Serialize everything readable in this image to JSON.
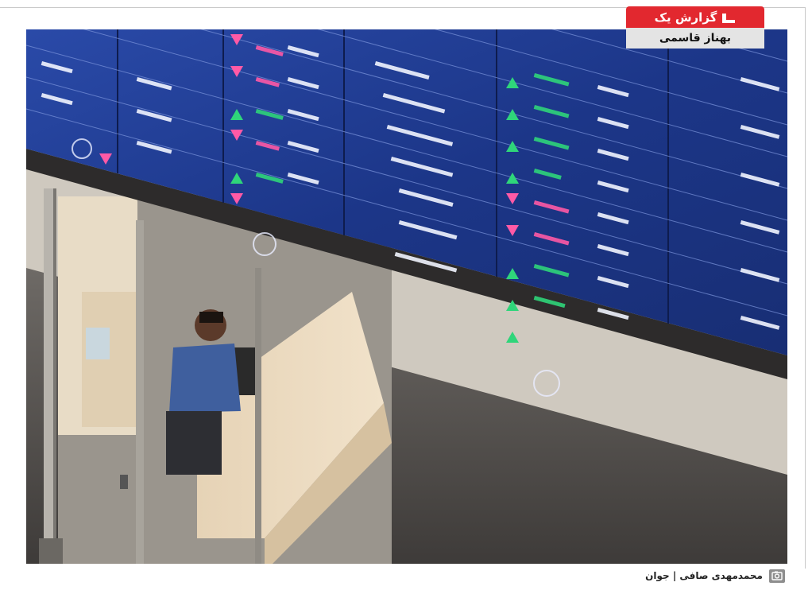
{
  "section_label": "گزارش یک",
  "author": "بهناز قاسمی",
  "photo_credit": "محمدمهدی صافی | جوان",
  "icons": {
    "section": "check-mark-icon",
    "credit": "camera-icon"
  },
  "colors": {
    "accent_red": "#e2282f",
    "author_bg": "#e4e4e4",
    "board_blue": "#1f3a8c",
    "value_green": "#2fd57a",
    "value_pink": "#ff5aa6"
  }
}
